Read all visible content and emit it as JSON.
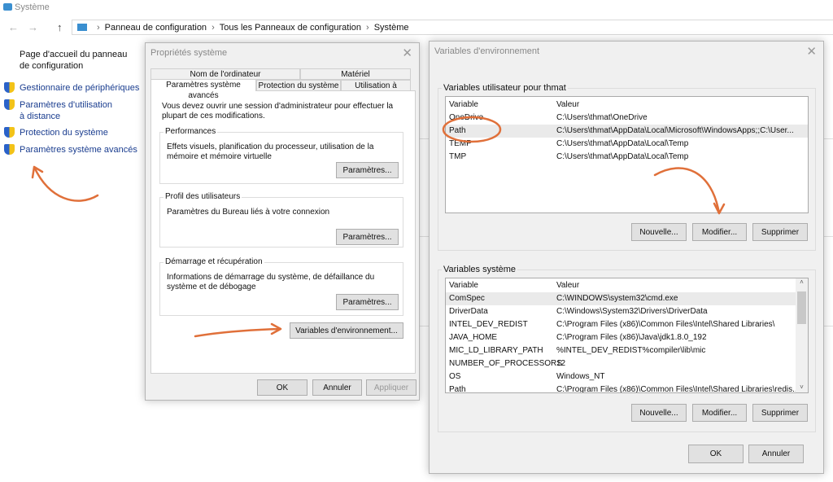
{
  "window": {
    "title": "Système"
  },
  "breadcrumb": [
    "Panneau de configuration",
    "Tous les Panneaux de configuration",
    "Système"
  ],
  "sidebar": {
    "home": "Page d'accueil du panneau de configuration",
    "items": [
      {
        "label": "Gestionnaire de périphériques"
      },
      {
        "label": "Paramètres d'utilisation à distance"
      },
      {
        "label": "Protection du système"
      },
      {
        "label": "Paramètres système avancés"
      }
    ]
  },
  "sysprops": {
    "title": "Propriétés système",
    "tabs_row1": [
      "Nom de l'ordinateur",
      "Matériel"
    ],
    "tabs_row2": [
      "Paramètres système avancés",
      "Protection du système",
      "Utilisation à distance"
    ],
    "selected_tab": "Paramètres système avancés",
    "notice": "Vous devez ouvrir une session d'administrateur pour effectuer la plupart de ces modifications.",
    "groups": [
      {
        "label": "Performances",
        "text": "Effets visuels, planification du processeur, utilisation de la mémoire et mémoire virtuelle",
        "button": "Paramètres..."
      },
      {
        "label": "Profil des utilisateurs",
        "text": "Paramètres du Bureau liés à votre connexion",
        "button": "Paramètres..."
      },
      {
        "label": "Démarrage et récupération",
        "text": "Informations de démarrage du système, de défaillance du système et de débogage",
        "button": "Paramètres..."
      }
    ],
    "env_button": "Variables d'environnement...",
    "ok": "OK",
    "cancel": "Annuler",
    "apply": "Appliquer"
  },
  "envvars": {
    "title": "Variables d'environnement",
    "user_label": "Variables utilisateur pour thmat",
    "columns": [
      "Variable",
      "Valeur"
    ],
    "user_rows": [
      [
        "OneDrive",
        "C:\\Users\\thmat\\OneDrive"
      ],
      [
        "Path",
        "C:\\Users\\thmat\\AppData\\Local\\Microsoft\\WindowsApps;;C:\\User..."
      ],
      [
        "TEMP",
        "C:\\Users\\thmat\\AppData\\Local\\Temp"
      ],
      [
        "TMP",
        "C:\\Users\\thmat\\AppData\\Local\\Temp"
      ]
    ],
    "user_selected": 1,
    "system_label": "Variables système",
    "system_rows": [
      [
        "ComSpec",
        "C:\\WINDOWS\\system32\\cmd.exe"
      ],
      [
        "DriverData",
        "C:\\Windows\\System32\\Drivers\\DriverData"
      ],
      [
        "INTEL_DEV_REDIST",
        "C:\\Program Files (x86)\\Common Files\\Intel\\Shared Libraries\\"
      ],
      [
        "JAVA_HOME",
        "C:\\Program Files (x86)\\Java\\jdk1.8.0_192"
      ],
      [
        "MIC_LD_LIBRARY_PATH",
        "%INTEL_DEV_REDIST%compiler\\lib\\mic"
      ],
      [
        "NUMBER_OF_PROCESSORS",
        "12"
      ],
      [
        "OS",
        "Windows_NT"
      ],
      [
        "Path",
        "C:\\Program Files (x86)\\Common Files\\Intel\\Shared Libraries\\redis..."
      ]
    ],
    "system_selected": 0,
    "new": "Nouvelle...",
    "edit": "Modifier...",
    "delete": "Supprimer",
    "ok": "OK",
    "cancel": "Annuler"
  },
  "annotation_color": "#e0703a"
}
